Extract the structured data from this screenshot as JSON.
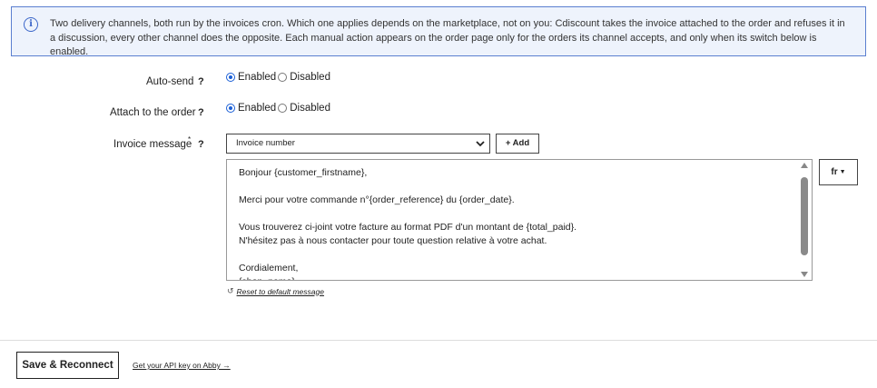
{
  "info": {
    "icon": "info-icon",
    "text": "Two delivery channels, both run by the invoices cron. Which one applies depends on the marketplace, not on you: Cdiscount takes the invoice attached to the order and refuses it in a discussion, every other channel does the opposite. Each manual action appears on the order page only for the orders its channel accepts, and only when its switch below is enabled."
  },
  "auto_send": {
    "label": "Auto-send",
    "help": "?",
    "options": [
      {
        "label": "Enabled",
        "checked": true
      },
      {
        "label": "Disabled",
        "checked": false
      }
    ]
  },
  "attach": {
    "label": "Attach to the order",
    "help": "?",
    "options": [
      {
        "label": "Enabled",
        "checked": true
      },
      {
        "label": "Disabled",
        "checked": false
      }
    ]
  },
  "invoice_message": {
    "label": "Invoice message",
    "required_mark": "*",
    "help": "?",
    "variable_select": "Invoice number",
    "add_label": "+ Add",
    "language": "fr",
    "body": "Bonjour {customer_firstname},\n\nMerci pour votre commande n°{order_reference} du {order_date}.\n\nVous trouverez ci-joint votre facture au format PDF d'un montant de {total_paid}.\nN'hésitez pas à nous contacter pour toute question relative à votre achat.\n\nCordialement,\n{shop_name}",
    "reset_label": "Reset to default message"
  },
  "footer": {
    "save_label": "Save & Reconnect",
    "api_link": "Get your API key on Abby →"
  },
  "colors": {
    "info_bg": "#eef3fc",
    "info_border": "#5b7fd0",
    "accent": "#1a5fd6"
  }
}
